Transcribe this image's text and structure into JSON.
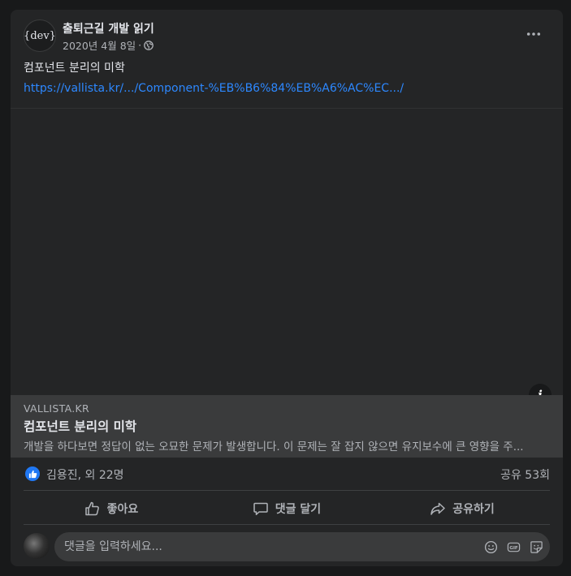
{
  "post": {
    "page_name": "출퇴근길 개발 읽기",
    "avatar_text": "{dev}",
    "date": "2020년 4월 8일",
    "separator": "·",
    "privacy_icon": "globe-icon",
    "text": "컴포넌트 분리의 미학",
    "link_url": "https://vallista.kr/.../Component-%EB%B6%84%EB%A6%AC%EC.../"
  },
  "link_preview": {
    "info_label": "i",
    "domain": "VALLISTA.KR",
    "title": "컴포넌트 분리의 미학",
    "description": "개발을 하다보면 정답이 없는 오묘한 문제가 발생합니다. 이 문제는 잘 잡지 않으면 유지보수에 큰 영향을 주..."
  },
  "reactions": {
    "names": "김용진, 외 22명",
    "shares": "공유 53회"
  },
  "actions": {
    "like": "좋아요",
    "comment": "댓글 달기",
    "share": "공유하기"
  },
  "comment_box": {
    "placeholder": "댓글을 입력하세요..."
  },
  "colors": {
    "background": "#18191a",
    "card": "#242526",
    "link": "#2d88ff",
    "like_badge": "#2078f4"
  }
}
